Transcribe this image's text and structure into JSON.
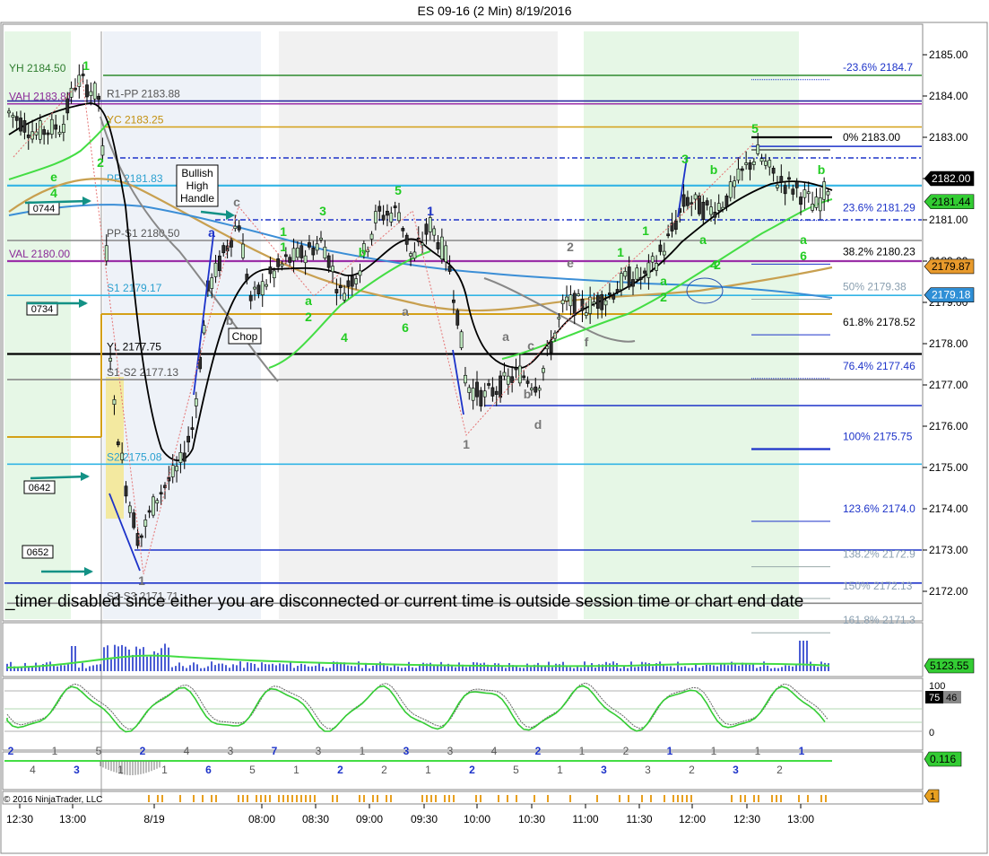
{
  "chart_data": {
    "type": "candlestick",
    "title": "ES 09-16 (2 Min)  8/19/2016",
    "ylim": [
      2171.0,
      2185.7
    ],
    "y_ticks": [
      "2185.00",
      "2184.00",
      "2183.00",
      "2182.00",
      "2181.00",
      "2180.00",
      "2179.00",
      "2178.00",
      "2177.00",
      "2176.00",
      "2175.00",
      "2174.00",
      "2173.00",
      "2172.00"
    ],
    "x_ticks": [
      "12:30",
      "13:00",
      "8/19",
      "08:00",
      "08:30",
      "09:00",
      "09:30",
      "10:00",
      "10:30",
      "11:00",
      "11:30",
      "12:00",
      "12:30",
      "13:00"
    ],
    "levels": [
      {
        "label": "YH 2184.50",
        "value": 2184.5,
        "color": "#2e8b2e"
      },
      {
        "label": "R1-PP 2183.88",
        "value": 2183.88,
        "color": "#2a2aa0"
      },
      {
        "label": "VAH 2183.81",
        "value": 2183.81,
        "color": "#9b30a8"
      },
      {
        "label": "YC 2183.25",
        "value": 2183.25,
        "color": "#d4a017"
      },
      {
        "label": "PP 2181.83",
        "value": 2181.83,
        "color": "#33b5e5"
      },
      {
        "label": "PP-S1 2180.50",
        "value": 2180.5,
        "color": "#888888"
      },
      {
        "label": "VAL 2180.00",
        "value": 2180.0,
        "color": "#9b30a8"
      },
      {
        "label": "S1 2179.17",
        "value": 2179.17,
        "color": "#33b5e5"
      },
      {
        "label": "YL 2177.75",
        "value": 2177.75,
        "color": "#000000"
      },
      {
        "label": "S1-S2 2177.13",
        "value": 2177.13,
        "color": "#888888"
      },
      {
        "label": "S2 2175.08",
        "value": 2175.08,
        "color": "#33b5e5"
      },
      {
        "label": "S2-S3 2171.71",
        "value": 2171.71,
        "color": "#888888"
      }
    ],
    "fib_levels": [
      {
        "label": "-23.6%  2184.7",
        "value": 2184.7
      },
      {
        "label": "0%  2183.00",
        "value": 2183.0
      },
      {
        "label": "23.6%  2181.29",
        "value": 2181.29
      },
      {
        "label": "38.2%  2180.23",
        "value": 2180.23
      },
      {
        "label": "50%  2179.38",
        "value": 2179.38
      },
      {
        "label": "61.8%  2178.52",
        "value": 2178.52
      },
      {
        "label": "76.4%  2177.46",
        "value": 2177.46
      },
      {
        "label": "100%  2175.75",
        "value": 2175.75
      },
      {
        "label": "123.6%  2174.0",
        "value": 2174.0
      },
      {
        "label": "138.2%  2172.9",
        "value": 2172.9
      },
      {
        "label": "150%  2172.13",
        "value": 2172.13
      },
      {
        "label": "161.8%  2171.3",
        "value": 2171.3
      }
    ],
    "price_markers": [
      {
        "label": "2182.00",
        "value": 2182.0,
        "bg": "#000000",
        "fg": "#ffffff"
      },
      {
        "label": "2181.44",
        "value": 2181.44,
        "bg": "#33cc33",
        "fg": "#000000"
      },
      {
        "label": "2179.87",
        "value": 2179.87,
        "bg": "#e89a2c",
        "fg": "#000000"
      },
      {
        "label": "2179.18",
        "value": 2179.18,
        "bg": "#2f8fd6",
        "fg": "#ffffff"
      }
    ],
    "time_boxes": [
      "0744",
      "0734",
      "0642",
      "0652"
    ],
    "annotations": [
      "Bullish High Handle",
      "Chop"
    ],
    "wave_labels": [
      "1",
      "2",
      "4",
      "e",
      "c",
      "a",
      "b",
      "1",
      "a",
      "3",
      "2",
      "4",
      "b",
      "5",
      "1",
      "a",
      "6",
      "1",
      "1",
      "a",
      "c",
      "b",
      "d",
      "2",
      "e",
      "f",
      "1",
      "2",
      "1",
      "a",
      "2",
      "3",
      "b",
      "5",
      "b",
      "a",
      "4",
      "a",
      "6",
      "1"
    ],
    "message": "_timer disabled since either you are disconnected or current time is outside session time or chart end date",
    "volume_marker": "5123.55",
    "stoch_ticks": [
      "100",
      "0"
    ],
    "stoch_marker": "75",
    "stoch_marker2": "46",
    "osc_marker": "0.116",
    "bottom_marker": "1",
    "copyright": "© 2016 NinjaTrader, LLC",
    "osc_labels": [
      "2",
      "4",
      "1",
      "3",
      "5",
      "1",
      "2",
      "1",
      "4",
      "6",
      "3",
      "5",
      "7",
      "1",
      "3",
      "2",
      "1",
      "2",
      "3",
      "1",
      "3",
      "2",
      "4",
      "5",
      "2",
      "1",
      "1",
      "3",
      "2",
      "3",
      "1",
      "2",
      "1",
      "3",
      "1",
      "2",
      "1"
    ]
  }
}
